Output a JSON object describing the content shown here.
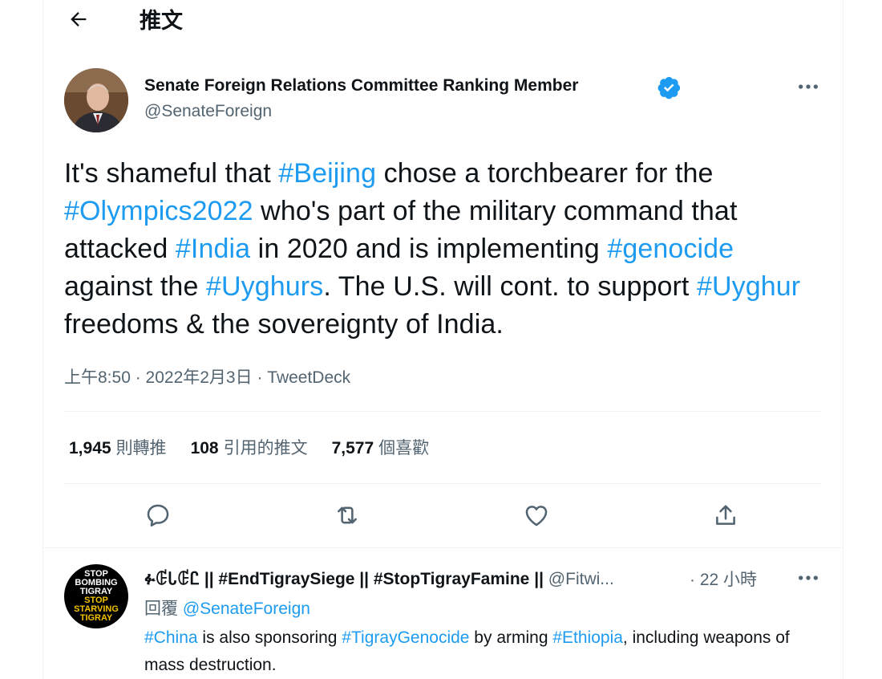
{
  "header": {
    "title": "推文",
    "back_icon": "arrow-left-icon"
  },
  "tweet": {
    "author_name": "Senate Foreign Relations Committee Ranking Member",
    "handle": "@SenateForeign",
    "verified_color": "#1d9bf0",
    "text_parts": [
      "It's shameful that ",
      "#Beijing",
      " chose a torchbearer for the ",
      "#Olympics2022",
      " who's part of the military command that attacked ",
      "#India",
      " in 2020 and is implementing ",
      "#genocide",
      " against the ",
      "#Uyghurs",
      ". The U.S. will cont. to support ",
      "#Uyghur",
      " freedoms & the sovereignty of India."
    ],
    "meta": "上午8:50 · 2022年2月3日 · TweetDeck",
    "stats": {
      "retweets_count": "1,945",
      "retweets_label": "則轉推",
      "quotes_count": "108",
      "quotes_label": "引用的推文",
      "likes_count": "7,577",
      "likes_label": "個喜歡"
    },
    "actions": [
      "reply-icon",
      "retweet-icon",
      "like-icon",
      "share-icon"
    ]
  },
  "reply": {
    "avatar_lines": [
      "STOP",
      "BOMBING",
      "TIGRAY",
      "STOP",
      "STARVING",
      "TIGRAY"
    ],
    "author_name": "ፉꂅᏓꂅᏝ || #EndTigraySiege || #StopTigrayFamine ||",
    "handle": "@Fitwi...",
    "time": "· 22 小時",
    "reply_to_label": "回覆",
    "reply_to_handle": "@SenateForeign",
    "text_parts": [
      "#China",
      " is also sponsoring ",
      "#TigrayGenocide",
      " by arming ",
      "#Ethiopia",
      ", including weapons of mass destruction."
    ]
  },
  "colors": {
    "accent": "#1d9bf0",
    "text": "#0f1419",
    "muted": "#536471",
    "border": "#eff3f4"
  }
}
